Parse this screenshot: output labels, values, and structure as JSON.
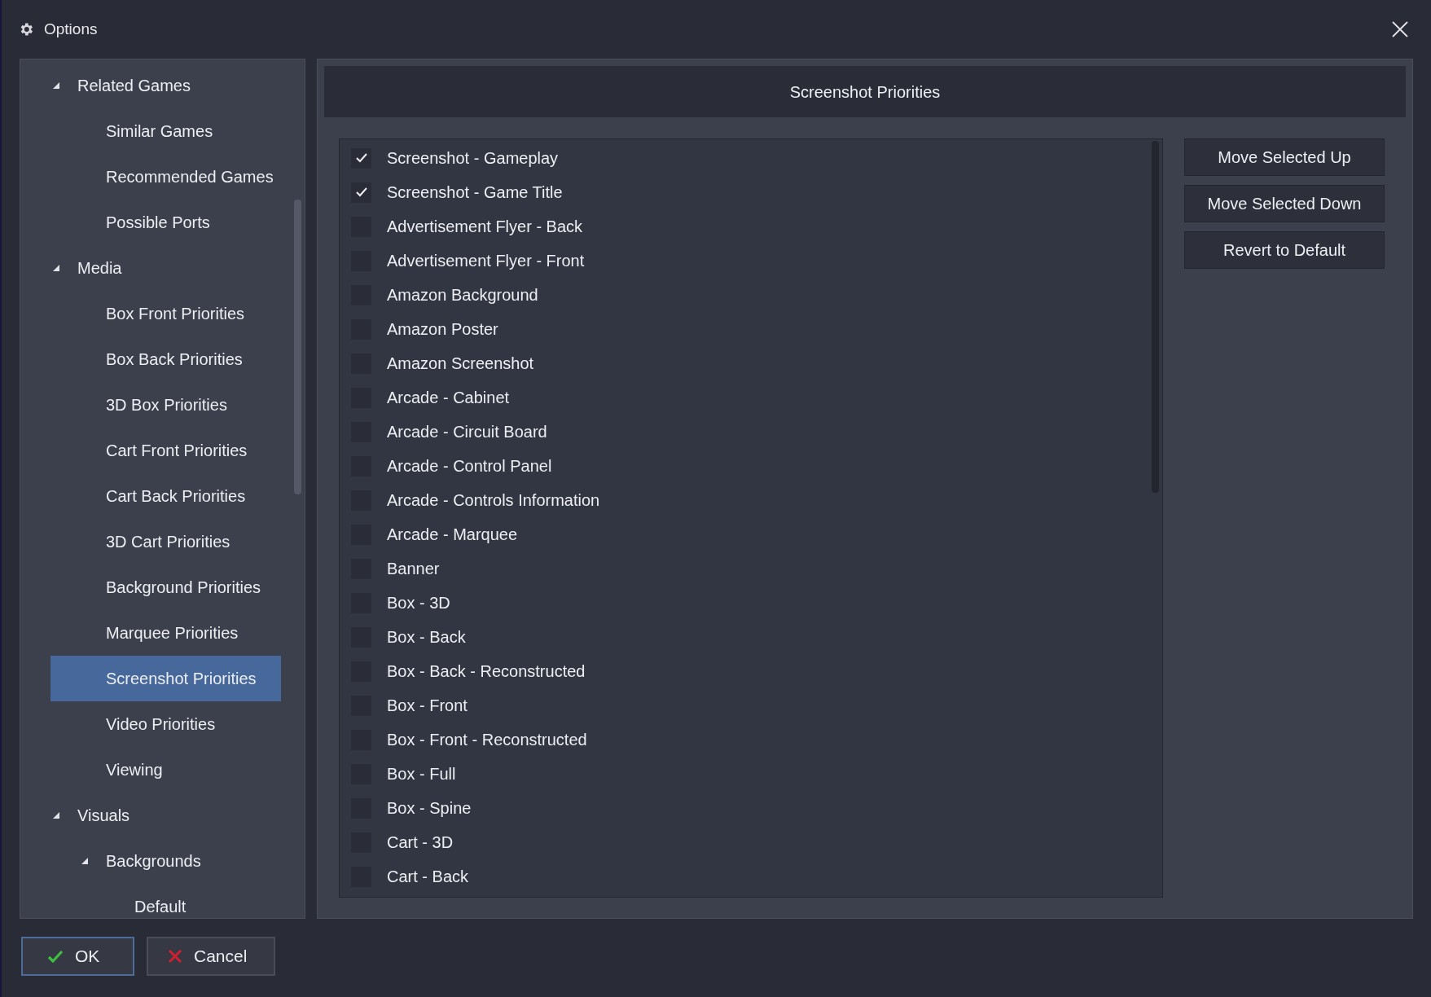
{
  "window": {
    "title": "Options"
  },
  "tree": [
    {
      "label": "Related Games",
      "expanded": true,
      "selected": false,
      "children": [
        {
          "label": "Similar Games",
          "selected": false
        },
        {
          "label": "Recommended Games",
          "selected": false
        },
        {
          "label": "Possible Ports",
          "selected": false
        }
      ]
    },
    {
      "label": "Media",
      "expanded": true,
      "selected": false,
      "children": [
        {
          "label": "Box Front Priorities",
          "selected": false
        },
        {
          "label": "Box Back Priorities",
          "selected": false
        },
        {
          "label": "3D Box Priorities",
          "selected": false
        },
        {
          "label": "Cart Front Priorities",
          "selected": false
        },
        {
          "label": "Cart Back Priorities",
          "selected": false
        },
        {
          "label": "3D Cart Priorities",
          "selected": false
        },
        {
          "label": "Background Priorities",
          "selected": false
        },
        {
          "label": "Marquee Priorities",
          "selected": false
        },
        {
          "label": "Screenshot Priorities",
          "selected": true
        },
        {
          "label": "Video Priorities",
          "selected": false
        },
        {
          "label": "Viewing",
          "selected": false
        }
      ]
    },
    {
      "label": "Visuals",
      "expanded": true,
      "selected": false,
      "children": [
        {
          "label": "Backgrounds",
          "expanded": true,
          "selected": false,
          "children": [
            {
              "label": "Default",
              "selected": false
            }
          ]
        }
      ]
    }
  ],
  "panel": {
    "title": "Screenshot Priorities",
    "items": [
      {
        "label": "Screenshot - Gameplay",
        "checked": true
      },
      {
        "label": "Screenshot - Game Title",
        "checked": true
      },
      {
        "label": "Advertisement Flyer - Back",
        "checked": false
      },
      {
        "label": "Advertisement Flyer - Front",
        "checked": false
      },
      {
        "label": "Amazon Background",
        "checked": false
      },
      {
        "label": "Amazon Poster",
        "checked": false
      },
      {
        "label": "Amazon Screenshot",
        "checked": false
      },
      {
        "label": "Arcade - Cabinet",
        "checked": false
      },
      {
        "label": "Arcade - Circuit Board",
        "checked": false
      },
      {
        "label": "Arcade - Control Panel",
        "checked": false
      },
      {
        "label": "Arcade - Controls Information",
        "checked": false
      },
      {
        "label": "Arcade - Marquee",
        "checked": false
      },
      {
        "label": "Banner",
        "checked": false
      },
      {
        "label": "Box - 3D",
        "checked": false
      },
      {
        "label": "Box - Back",
        "checked": false
      },
      {
        "label": "Box - Back - Reconstructed",
        "checked": false
      },
      {
        "label": "Box - Front",
        "checked": false
      },
      {
        "label": "Box - Front - Reconstructed",
        "checked": false
      },
      {
        "label": "Box - Full",
        "checked": false
      },
      {
        "label": "Box - Spine",
        "checked": false
      },
      {
        "label": "Cart - 3D",
        "checked": false
      },
      {
        "label": "Cart - Back",
        "checked": false
      }
    ],
    "buttons": [
      "Move Selected Up",
      "Move Selected Down",
      "Revert to Default"
    ]
  },
  "footer": {
    "ok": "OK",
    "cancel": "Cancel"
  }
}
